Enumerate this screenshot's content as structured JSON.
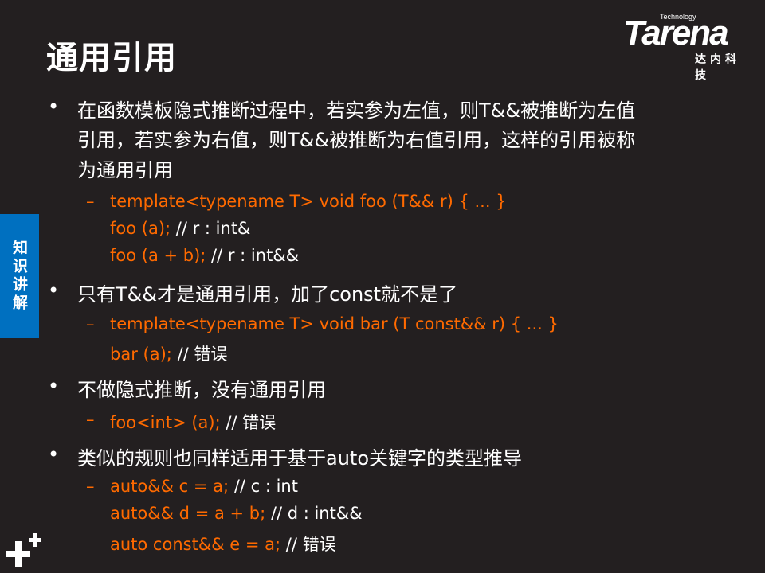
{
  "title": "通用引用",
  "logo": {
    "brand": "Tarena",
    "tagline": "Technology",
    "cn": "达内科技"
  },
  "side_tab": "知识讲解",
  "bullets": [
    {
      "lines": [
        "在函数模板隐式推断过程中，若实参为左值，则T&&被推断为左值",
        "引用，若实参为右值，则T&&被推断为右值引用，这样的引用被称",
        "为通用引用"
      ],
      "sub": [
        {
          "code": "template<typename T> void foo (T&& r) { ... }",
          "comment": ""
        },
        {
          "code": "foo (a);",
          "comment": " // r : int&"
        },
        {
          "code": "foo (a + b);",
          "comment": " // r : int&&"
        }
      ]
    },
    {
      "lines": [
        "只有T&&才是通用引用，加了const就不是了"
      ],
      "sub": [
        {
          "code": "template<typename T> void bar (T const&& r) { ... }",
          "comment": ""
        },
        {
          "code": "bar (a);",
          "comment": " // 错误"
        }
      ]
    },
    {
      "lines": [
        "不做隐式推断，没有通用引用"
      ],
      "sub": [
        {
          "code": "foo<int> (a);",
          "comment": " // 错误"
        }
      ]
    },
    {
      "lines": [
        "类似的规则也同样适用于基于auto关键字的类型推导"
      ],
      "sub": [
        {
          "code": "auto&& c = a;",
          "comment": " // c : int"
        },
        {
          "code": "auto&& d = a + b;",
          "comment": " // d : int&&"
        },
        {
          "code": "auto const&& e = a;",
          "comment": " // 错误"
        }
      ]
    }
  ],
  "colors": {
    "background": "#231f20",
    "accent": "#ff6a00",
    "tab": "#0070c0"
  }
}
